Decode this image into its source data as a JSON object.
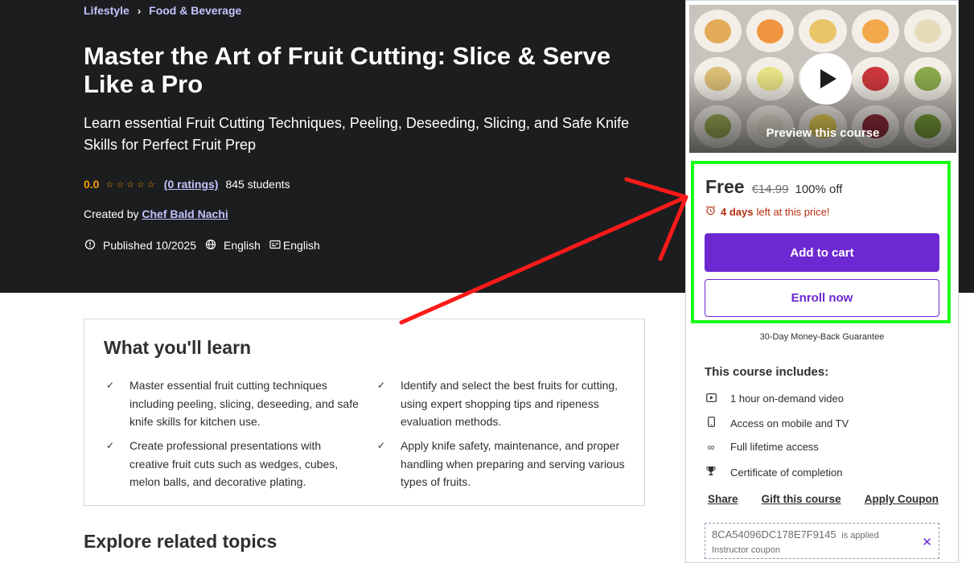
{
  "breadcrumb": {
    "items": [
      "Lifestyle",
      "Food & Beverage"
    ],
    "separator": "›"
  },
  "course": {
    "title": "Master the Art of Fruit Cutting: Slice & Serve Like a Pro",
    "subtitle": "Learn essential Fruit Cutting Techniques, Peeling, Deseeding, Slicing, and Safe Knife Skills for Perfect Fruit Prep",
    "rating": "0.0",
    "stars": "☆☆☆☆☆",
    "ratings_link": "(0 ratings)",
    "students": "845 students",
    "created_by_label": "Created by",
    "instructor": "Chef Bald Nachi",
    "published": "Published 10/2025",
    "language": "English",
    "captions": "English"
  },
  "learn": {
    "title": "What you'll learn",
    "items": [
      "Master essential fruit cutting techniques including peeling, slicing, deseeding, and safe knife skills for kitchen use.",
      "Identify and select the best fruits for cutting, using expert shopping tips and ripeness evaluation methods.",
      "Create professional presentations with creative fruit cuts such as wedges, cubes, melon balls, and decorative plating.",
      "Apply knife safety, maintenance, and proper handling when preparing and serving various types of fruits."
    ]
  },
  "explore_title": "Explore related topics",
  "sidebar": {
    "preview_label": "Preview this course",
    "price": "Free",
    "original_price": "€14.99",
    "discount": "100% off",
    "timer_bold": "4 days",
    "timer_rest": "left at this price!",
    "add_to_cart": "Add to cart",
    "enroll": "Enroll now",
    "guarantee": "30-Day Money-Back Guarantee",
    "includes_title": "This course includes:",
    "includes": [
      "1 hour on-demand video",
      "Access on mobile and TV",
      "Full lifetime access",
      "Certificate of completion"
    ],
    "links": [
      "Share",
      "Gift this course",
      "Apply Coupon"
    ],
    "coupon_code": "8CA54096DC178E7F9145",
    "coupon_applied": "is applied",
    "coupon_sub": "Instructor coupon"
  },
  "colors": {
    "accent": "#6d28d2",
    "hero_bg": "#1c1d1f",
    "link_light": "#c0c4fc",
    "star": "#f69c08",
    "timer": "#b32d0f",
    "highlight": "#1aff1a",
    "annotation_arrow": "#ff0000"
  },
  "icons": {
    "breadcrumb_separator": "chevron-right-icon",
    "published": "alert-badge-icon",
    "language": "globe-icon",
    "captions": "closed-captions-icon",
    "learn_check": "check-icon",
    "play": "play-icon",
    "timer": "alarm-clock-icon",
    "includes": [
      "video-icon",
      "mobile-icon",
      "infinity-icon",
      "trophy-icon"
    ],
    "coupon_remove": "close-icon"
  }
}
